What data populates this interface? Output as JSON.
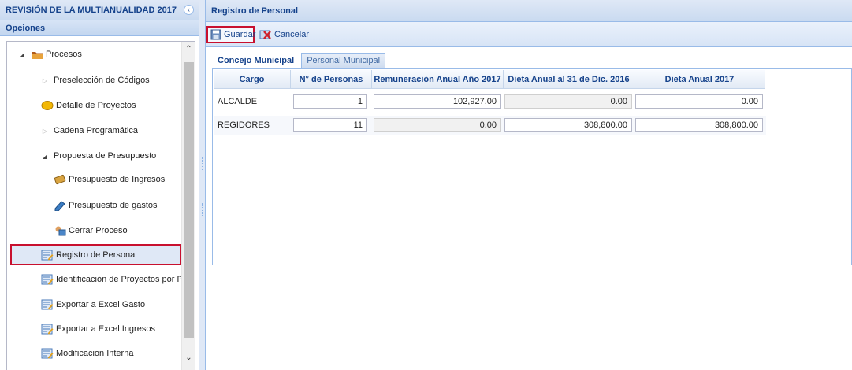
{
  "sidebar": {
    "title": "REVISIÓN DE LA MULTIANUALIDAD 2017",
    "section": "Opciones",
    "items": [
      {
        "label": "Procesos"
      },
      {
        "label": "Preselección de Códigos"
      },
      {
        "label": "Detalle de Proyectos"
      },
      {
        "label": "Cadena Programática"
      },
      {
        "label": "Propuesta de Presupuesto"
      },
      {
        "label": "Presupuesto de Ingresos"
      },
      {
        "label": "Presupuesto de gastos"
      },
      {
        "label": "Cerrar Proceso"
      },
      {
        "label": "Registro de Personal"
      },
      {
        "label": "Identificación de Proyectos por Prod"
      },
      {
        "label": "Exportar a Excel Gasto"
      },
      {
        "label": "Exportar a Excel Ingresos"
      },
      {
        "label": "Modificacion Interna"
      }
    ]
  },
  "main": {
    "title": "Registro de Personal",
    "toolbar": {
      "save_label": "Guardar",
      "cancel_label": "Cancelar"
    },
    "tabs": [
      {
        "label": "Concejo Municipal"
      },
      {
        "label": "Personal Municipal"
      }
    ],
    "grid": {
      "columns": [
        "Cargo",
        "N° de Personas",
        "Remuneración Anual Año 2017",
        "Dieta Anual al 31 de Dic. 2016",
        "Dieta Anual 2017"
      ],
      "rows": [
        {
          "cargo": "ALCALDE",
          "personas": "1",
          "remuneracion": "102,927.00",
          "dieta2016": "0.00",
          "dieta2017": "0.00"
        },
        {
          "cargo": "REGIDORES",
          "personas": "11",
          "remuneracion": "0.00",
          "dieta2016": "308,800.00",
          "dieta2017": "308,800.00"
        }
      ]
    }
  },
  "colors": {
    "header_text": "#15428b",
    "highlight": "#c8102e",
    "border": "#99bbe8"
  }
}
